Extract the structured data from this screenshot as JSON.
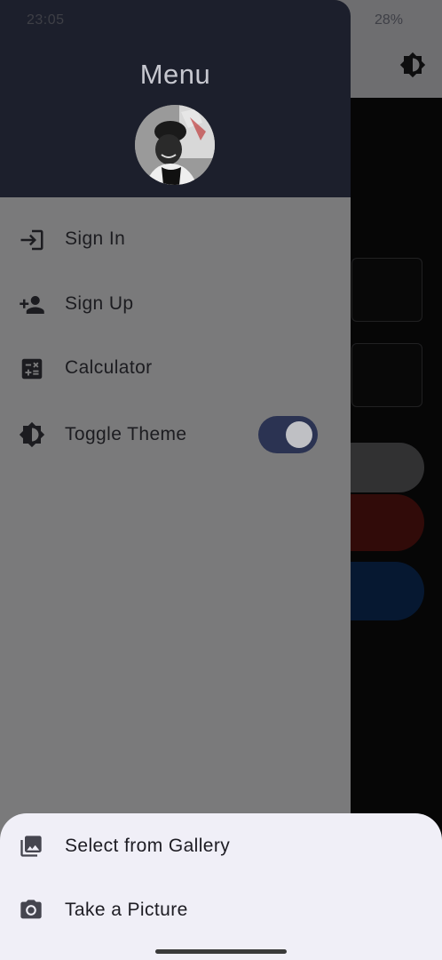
{
  "status_bar": {
    "time": "23:05",
    "battery": "28%"
  },
  "drawer": {
    "title": "Menu",
    "items": [
      {
        "label": "Sign In",
        "icon": "login-icon"
      },
      {
        "label": "Sign Up",
        "icon": "person-add-icon"
      },
      {
        "label": "Calculator",
        "icon": "calculate-icon"
      },
      {
        "label": "Toggle Theme",
        "icon": "brightness-icon",
        "toggle_on": true
      }
    ]
  },
  "bottom_sheet": {
    "options": [
      {
        "label": "Select from Gallery",
        "icon": "gallery-icon"
      },
      {
        "label": "Take a Picture",
        "icon": "camera-icon"
      }
    ]
  },
  "colors": {
    "drawer_header": "#1c1f2c",
    "toggle_track": "#2b3352",
    "sheet_background": "#f0eff7",
    "app_button_gray": "#5a5a5c",
    "app_button_red": "#5a1512",
    "app_button_blue": "#0b2c5a"
  }
}
